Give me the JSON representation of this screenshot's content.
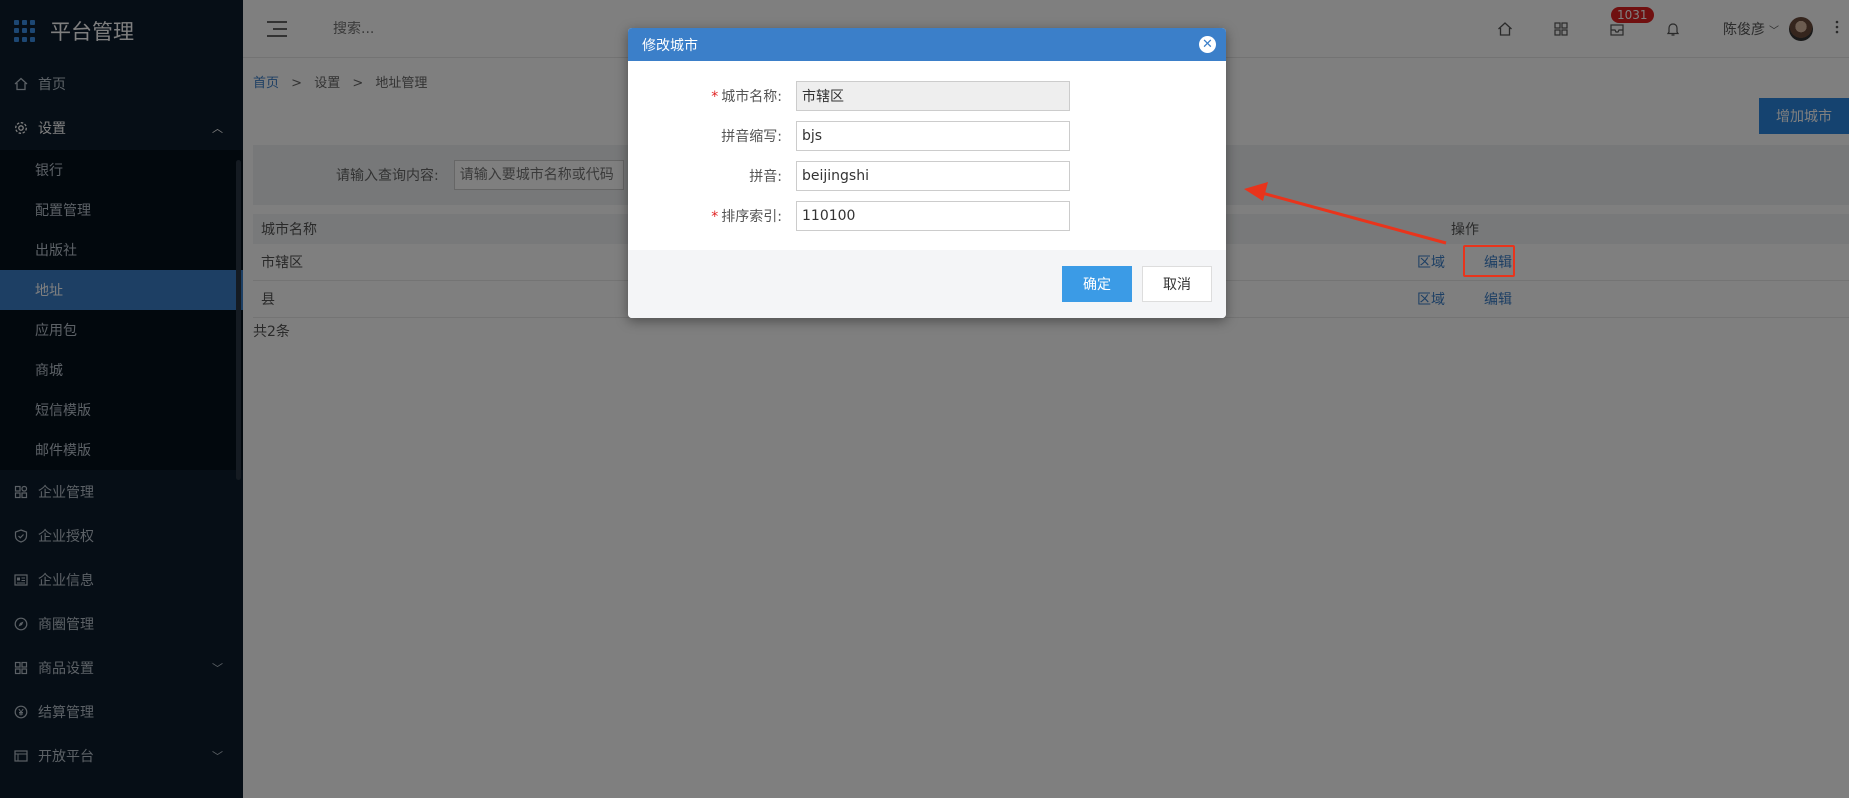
{
  "app": {
    "title": "平台管理"
  },
  "sidebar": {
    "items": [
      {
        "label": "首页",
        "icon": "home-icon"
      },
      {
        "label": "设置",
        "icon": "gear-icon"
      }
    ],
    "settings_sub": [
      "银行",
      "配置管理",
      "出版社",
      "地址",
      "应用包",
      "商城",
      "短信模版",
      "邮件模版"
    ],
    "active_sub": "地址",
    "bottom_items": [
      {
        "label": "企业管理",
        "icon": "enterprise-icon"
      },
      {
        "label": "企业授权",
        "icon": "shield-check-icon"
      },
      {
        "label": "企业信息",
        "icon": "info-card-icon"
      },
      {
        "label": "商圈管理",
        "icon": "compass-icon"
      },
      {
        "label": "商品设置",
        "icon": "grid-icon"
      },
      {
        "label": "结算管理",
        "icon": "currency-icon"
      },
      {
        "label": "开放平台",
        "icon": "list-icon"
      }
    ]
  },
  "header": {
    "search_placeholder": "搜索...",
    "badge_count": "1031",
    "user_name": "陈俊彦"
  },
  "breadcrumb": {
    "home": "首页",
    "level1": "设置",
    "level2": "地址管理"
  },
  "toolbar": {
    "add_label": "增加城市"
  },
  "filter": {
    "label": "请输入查询内容:",
    "placeholder": "请输入要城市名称或代码"
  },
  "table": {
    "headers": {
      "name": "城市名称",
      "ops": "操作"
    },
    "rows": [
      {
        "name": "市辖区",
        "op1": "区域",
        "op2": "编辑"
      },
      {
        "name": "县",
        "op1": "区域",
        "op2": "编辑"
      }
    ],
    "total": "共2条"
  },
  "modal": {
    "title": "修改城市",
    "fields": [
      {
        "label": "城市名称:",
        "value": "市辖区",
        "required": true
      },
      {
        "label": "拼音缩写:",
        "value": "bjs",
        "required": false
      },
      {
        "label": "拼音:",
        "value": "beijingshi",
        "required": false
      },
      {
        "label": "排序索引:",
        "value": "110100",
        "required": true
      }
    ],
    "ok_label": "确定",
    "cancel_label": "取消",
    "required_mark": "*"
  },
  "colors": {
    "accent": "#3b7fc9",
    "sidebar_bg": "#0c1c2c",
    "annotation": "#e8341c"
  }
}
